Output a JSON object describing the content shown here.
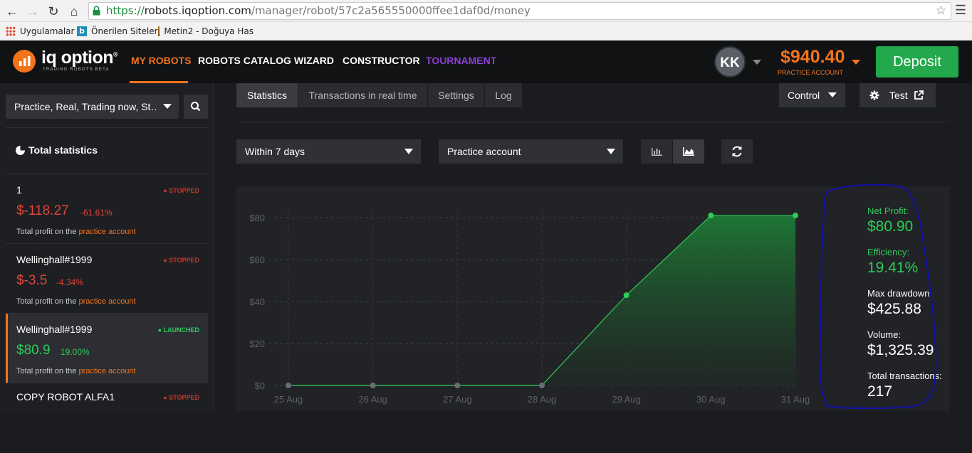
{
  "browser": {
    "url_scheme": "https://",
    "url_host": "robots.iqoption.com",
    "url_path": "/manager/robot/57c2a565550000ffee1daf0d/money",
    "bookmarks": [
      {
        "label": "Uygulamalar",
        "icon": "apps-grid-icon"
      },
      {
        "label": "Önerilen Siteler",
        "icon": "bing-icon"
      },
      {
        "label": "Metin2 - Doğuya Has",
        "icon": "metin2-icon"
      }
    ]
  },
  "header": {
    "logo_text": "iq option",
    "logo_mark": "®",
    "logo_sub": "TRADING ROBOTS BETA",
    "nav": [
      {
        "label": "MY ROBOTS",
        "active": true
      },
      {
        "label": "ROBOTS CATALOG"
      },
      {
        "label": "WIZARD"
      },
      {
        "label": "CONSTRUCTOR"
      },
      {
        "label": "TOURNAMENT"
      }
    ],
    "avatar_initials": "KK",
    "balance": "$940.40",
    "balance_sub": "PRACTICE ACCOUNT",
    "deposit_label": "Deposit"
  },
  "sidebar": {
    "filter_value": "Practice, Real, Trading now, St…",
    "total_statistics": "Total statistics",
    "footer_prefix": "Total profit on the",
    "footer_account": "practice account",
    "robots": [
      {
        "name": "1",
        "status": "● STOPPED",
        "value": "$-118.27",
        "pct": "-61.61%",
        "trend": "neg"
      },
      {
        "name": "Wellinghall#1999",
        "status": "● STOPPED",
        "value": "$-3.5",
        "pct": "-4.34%",
        "trend": "neg"
      },
      {
        "name": "Wellinghall#1999",
        "status": "● LAUNCHED",
        "value": "$80.9",
        "pct": "19.00%",
        "trend": "pos",
        "selected": true
      },
      {
        "name": "COPY ROBOT ALFA1",
        "status": "● STOPPED"
      }
    ]
  },
  "main": {
    "tabs": [
      {
        "label": "Statistics",
        "active": true
      },
      {
        "label": "Transactions in real time"
      },
      {
        "label": "Settings"
      },
      {
        "label": "Log"
      }
    ],
    "control_label": "Control",
    "test_label": "Test",
    "period_value": "Within 7 days",
    "account_value": "Practice account"
  },
  "stats": {
    "net_profit_label": "Net Profit:",
    "net_profit_value": "$80.90",
    "efficiency_label": "Efficiency:",
    "efficiency_value": "19.41%",
    "max_drawdown_label": "Max drawdown:",
    "max_drawdown_value": "$425.88",
    "volume_label": "Volume:",
    "volume_value": "$1,325.39",
    "total_transactions_label": "Total transactions:",
    "total_transactions_value": "217"
  },
  "colors": {
    "accent": "#f3731a",
    "positive": "#2ecc57",
    "negative": "#e0443a",
    "tournament": "#8b3fd6",
    "annotation": "#1111aa"
  },
  "chart_data": {
    "type": "area",
    "x": [
      "25 Aug",
      "26 Aug",
      "27 Aug",
      "28 Aug",
      "29 Aug",
      "30 Aug",
      "31 Aug"
    ],
    "y": [
      0,
      0,
      0,
      0,
      43,
      81,
      81
    ],
    "yticks": [
      "$0",
      "$20",
      "$40",
      "$60",
      "$80"
    ],
    "ylim": [
      0,
      80
    ],
    "grid": true,
    "color": "#2ecc57"
  }
}
